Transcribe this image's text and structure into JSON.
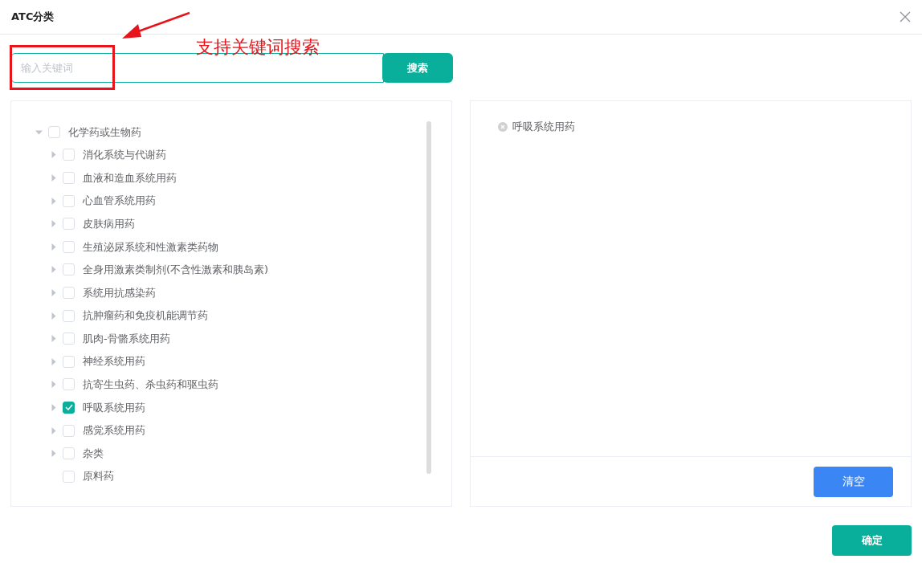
{
  "dialog": {
    "title": "ATC分类"
  },
  "annotation": {
    "text": "支持关键词搜索"
  },
  "search": {
    "placeholder": "输入关键词",
    "button": "搜索"
  },
  "tree": [
    {
      "label": "化学药或生物药",
      "checked": false,
      "expanded": true,
      "children": [
        {
          "label": "消化系统与代谢药",
          "checked": false,
          "expanded": false
        },
        {
          "label": "血液和造血系统用药",
          "checked": false,
          "expanded": false
        },
        {
          "label": "心血管系统用药",
          "checked": false,
          "expanded": false
        },
        {
          "label": "皮肤病用药",
          "checked": false,
          "expanded": false
        },
        {
          "label": "生殖泌尿系统和性激素类药物",
          "checked": false,
          "expanded": false
        },
        {
          "label": "全身用激素类制剂(不含性激素和胰岛素)",
          "checked": false,
          "expanded": false
        },
        {
          "label": "系统用抗感染药",
          "checked": false,
          "expanded": false
        },
        {
          "label": "抗肿瘤药和免疫机能调节药",
          "checked": false,
          "expanded": false
        },
        {
          "label": "肌肉-骨骼系统用药",
          "checked": false,
          "expanded": false
        },
        {
          "label": "神经系统用药",
          "checked": false,
          "expanded": false
        },
        {
          "label": "抗寄生虫药、杀虫药和驱虫药",
          "checked": false,
          "expanded": false
        },
        {
          "label": "呼吸系统用药",
          "checked": true,
          "expanded": false
        },
        {
          "label": "感觉系统用药",
          "checked": false,
          "expanded": false
        },
        {
          "label": "杂类",
          "checked": false,
          "expanded": false
        },
        {
          "label": "原料药",
          "checked": false
        }
      ]
    }
  ],
  "selected_tags": [
    "呼吸系统用药"
  ],
  "clear_button": "清空",
  "confirm_button": "确定"
}
